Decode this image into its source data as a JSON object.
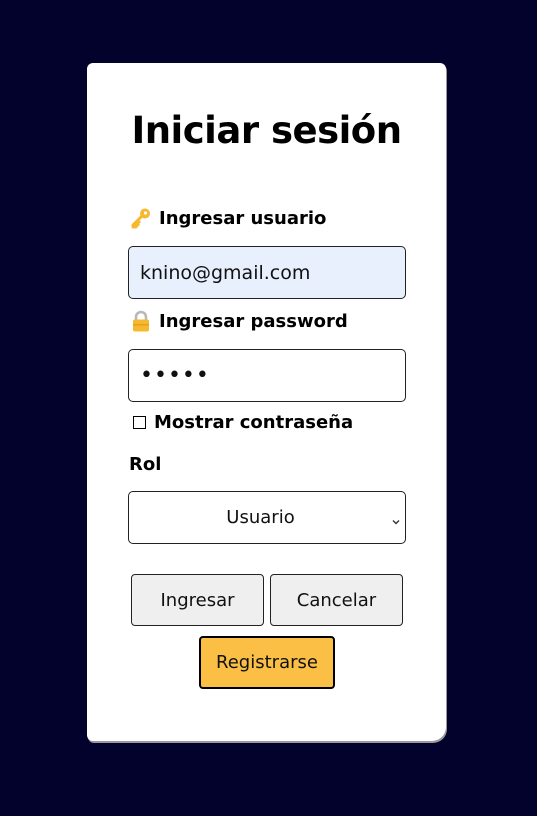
{
  "login": {
    "title": "Iniciar sesión",
    "username_label": "Ingresar usuario",
    "username_value": "knino@gmail.com",
    "password_label": "Ingresar password",
    "password_value": "12345",
    "show_password_label": "Mostrar contraseña",
    "role_label": "Rol",
    "role_selected": "Usuario",
    "buttons": {
      "login": "Ingresar",
      "cancel": "Cancelar",
      "register": "Registrarse"
    }
  },
  "icons": {
    "username": "key-icon",
    "password": "lock-icon",
    "select": "chevron-down-icon"
  },
  "colors": {
    "background": "#03022c",
    "card": "#ffffff",
    "autofill": "#e8f0fe",
    "register_button": "#fbbf45"
  }
}
